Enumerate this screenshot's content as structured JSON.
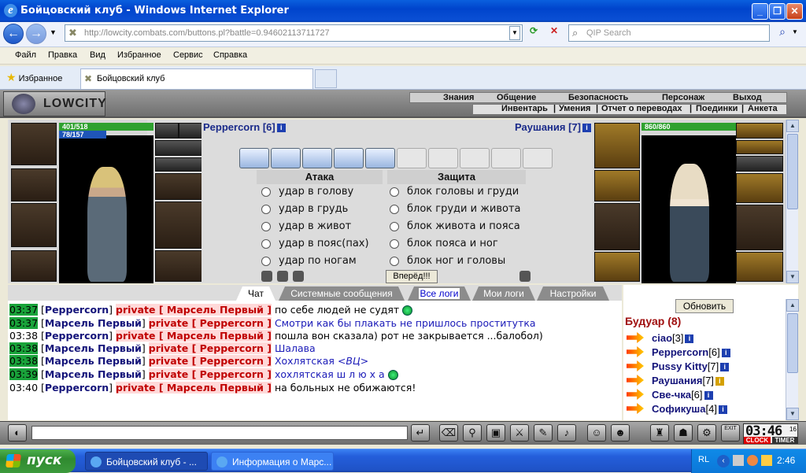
{
  "window": {
    "title": "Бойцовский клуб - Windows Internet Explorer"
  },
  "browser": {
    "url": "http://lowcity.combats.com/buttons.pl?battle=0.94602113711727",
    "search_placeholder": "QIP Search",
    "menu": [
      "Файл",
      "Правка",
      "Вид",
      "Избранное",
      "Сервис",
      "Справка"
    ],
    "favorites_label": "Избранное",
    "tab_title": "Бойцовский клуб"
  },
  "game": {
    "logo": "LOWCITY",
    "menu_top": [
      "Знания",
      "Общение",
      "Безопасность",
      "Персонаж",
      "Выход"
    ],
    "menu_bottom": [
      "Инвентарь",
      "Умения",
      "Отчет о переводах",
      "Поединки",
      "Анкета"
    ]
  },
  "battle": {
    "player": {
      "name": "Peppercorn [6]",
      "hp": "401/518",
      "mana": "78/157"
    },
    "enemy": {
      "name": "Раушания [7]",
      "hp": "860/860"
    },
    "attack_header": "Атака",
    "defense_header": "Защита",
    "attacks": [
      "удар в голову",
      "удар в грудь",
      "удар в живот",
      "удар в пояс(пах)",
      "удар по ногам"
    ],
    "defenses": [
      "блок головы и груди",
      "блок груди и живота",
      "блок живота и пояса",
      "блок пояса и ног",
      "блок ног и головы"
    ],
    "forward_button": "Вперёд!!!",
    "scrolls_active": 5,
    "scrolls_total": 10
  },
  "chat": {
    "tabs": [
      "Чат",
      "Системные сообщения",
      "Все логи",
      "Мои логи",
      "Настройки"
    ],
    "messages": [
      {
        "time": "03:37",
        "from": "Peppercorn",
        "to": "Марсель Первый",
        "text": "по себе людей не судят"
      },
      {
        "time": "03:37",
        "from": "Марсель Первый",
        "to": "Peppercorn",
        "text": "Смотри как бы плакать не пришлось проститутка"
      },
      {
        "time": "03:38",
        "from": "Peppercorn",
        "to": "Марсель Первый",
        "text": "пошла вон сказала) рот не закрывается ...балобол)"
      },
      {
        "time": "03:38",
        "from": "Марсель Первый",
        "to": "Peppercorn",
        "text": "Шалава"
      },
      {
        "time": "03:38",
        "from": "Марсель Первый",
        "to": "Peppercorn",
        "text": "Хохлятская",
        "tag": "<ВЦ>"
      },
      {
        "time": "03:39",
        "from": "Марсель Первый",
        "to": "Peppercorn",
        "text": "хохлятская ш л ю х а"
      },
      {
        "time": "03:40",
        "from": "Peppercorn",
        "to": "Марсель Первый",
        "text": "на больных не обижаются!"
      }
    ],
    "bracket_open": "[",
    "bracket_close": "]",
    "private_label": "private",
    "private_open": "[ ",
    "private_close": " ]"
  },
  "room": {
    "refresh_button": "Обновить",
    "name": "Будуар (8)",
    "users": [
      {
        "name": "ciao",
        "level": "[3]"
      },
      {
        "name": "Peppercorn",
        "level": "[6]"
      },
      {
        "name": "Pussy Kitty",
        "level": "[7]"
      },
      {
        "name": "Раушания",
        "level": "[7]"
      },
      {
        "name": "Све-чка",
        "level": "[6]"
      },
      {
        "name": "Софикуша",
        "level": "[4]"
      }
    ]
  },
  "clock": {
    "time": "03:46",
    "seconds": "16",
    "clock_label": "CLOCK",
    "timer_label": "TIMER",
    "exit_label": "EXIT"
  },
  "taskbar": {
    "start": "пуск",
    "tasks": [
      "Бойцовский клуб - ...",
      "Информация о Марс..."
    ],
    "lang": "RL",
    "time": "2:46"
  }
}
